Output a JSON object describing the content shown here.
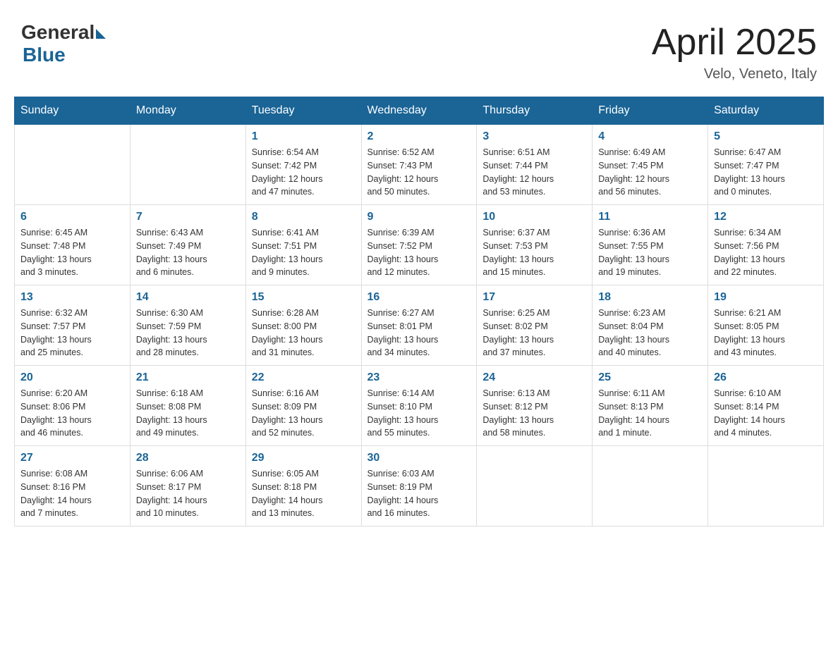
{
  "header": {
    "logo_general": "General",
    "logo_blue": "Blue",
    "title": "April 2025",
    "location": "Velo, Veneto, Italy"
  },
  "calendar": {
    "days_of_week": [
      "Sunday",
      "Monday",
      "Tuesday",
      "Wednesday",
      "Thursday",
      "Friday",
      "Saturday"
    ],
    "weeks": [
      [
        {
          "day": "",
          "info": ""
        },
        {
          "day": "",
          "info": ""
        },
        {
          "day": "1",
          "info": "Sunrise: 6:54 AM\nSunset: 7:42 PM\nDaylight: 12 hours\nand 47 minutes."
        },
        {
          "day": "2",
          "info": "Sunrise: 6:52 AM\nSunset: 7:43 PM\nDaylight: 12 hours\nand 50 minutes."
        },
        {
          "day": "3",
          "info": "Sunrise: 6:51 AM\nSunset: 7:44 PM\nDaylight: 12 hours\nand 53 minutes."
        },
        {
          "day": "4",
          "info": "Sunrise: 6:49 AM\nSunset: 7:45 PM\nDaylight: 12 hours\nand 56 minutes."
        },
        {
          "day": "5",
          "info": "Sunrise: 6:47 AM\nSunset: 7:47 PM\nDaylight: 13 hours\nand 0 minutes."
        }
      ],
      [
        {
          "day": "6",
          "info": "Sunrise: 6:45 AM\nSunset: 7:48 PM\nDaylight: 13 hours\nand 3 minutes."
        },
        {
          "day": "7",
          "info": "Sunrise: 6:43 AM\nSunset: 7:49 PM\nDaylight: 13 hours\nand 6 minutes."
        },
        {
          "day": "8",
          "info": "Sunrise: 6:41 AM\nSunset: 7:51 PM\nDaylight: 13 hours\nand 9 minutes."
        },
        {
          "day": "9",
          "info": "Sunrise: 6:39 AM\nSunset: 7:52 PM\nDaylight: 13 hours\nand 12 minutes."
        },
        {
          "day": "10",
          "info": "Sunrise: 6:37 AM\nSunset: 7:53 PM\nDaylight: 13 hours\nand 15 minutes."
        },
        {
          "day": "11",
          "info": "Sunrise: 6:36 AM\nSunset: 7:55 PM\nDaylight: 13 hours\nand 19 minutes."
        },
        {
          "day": "12",
          "info": "Sunrise: 6:34 AM\nSunset: 7:56 PM\nDaylight: 13 hours\nand 22 minutes."
        }
      ],
      [
        {
          "day": "13",
          "info": "Sunrise: 6:32 AM\nSunset: 7:57 PM\nDaylight: 13 hours\nand 25 minutes."
        },
        {
          "day": "14",
          "info": "Sunrise: 6:30 AM\nSunset: 7:59 PM\nDaylight: 13 hours\nand 28 minutes."
        },
        {
          "day": "15",
          "info": "Sunrise: 6:28 AM\nSunset: 8:00 PM\nDaylight: 13 hours\nand 31 minutes."
        },
        {
          "day": "16",
          "info": "Sunrise: 6:27 AM\nSunset: 8:01 PM\nDaylight: 13 hours\nand 34 minutes."
        },
        {
          "day": "17",
          "info": "Sunrise: 6:25 AM\nSunset: 8:02 PM\nDaylight: 13 hours\nand 37 minutes."
        },
        {
          "day": "18",
          "info": "Sunrise: 6:23 AM\nSunset: 8:04 PM\nDaylight: 13 hours\nand 40 minutes."
        },
        {
          "day": "19",
          "info": "Sunrise: 6:21 AM\nSunset: 8:05 PM\nDaylight: 13 hours\nand 43 minutes."
        }
      ],
      [
        {
          "day": "20",
          "info": "Sunrise: 6:20 AM\nSunset: 8:06 PM\nDaylight: 13 hours\nand 46 minutes."
        },
        {
          "day": "21",
          "info": "Sunrise: 6:18 AM\nSunset: 8:08 PM\nDaylight: 13 hours\nand 49 minutes."
        },
        {
          "day": "22",
          "info": "Sunrise: 6:16 AM\nSunset: 8:09 PM\nDaylight: 13 hours\nand 52 minutes."
        },
        {
          "day": "23",
          "info": "Sunrise: 6:14 AM\nSunset: 8:10 PM\nDaylight: 13 hours\nand 55 minutes."
        },
        {
          "day": "24",
          "info": "Sunrise: 6:13 AM\nSunset: 8:12 PM\nDaylight: 13 hours\nand 58 minutes."
        },
        {
          "day": "25",
          "info": "Sunrise: 6:11 AM\nSunset: 8:13 PM\nDaylight: 14 hours\nand 1 minute."
        },
        {
          "day": "26",
          "info": "Sunrise: 6:10 AM\nSunset: 8:14 PM\nDaylight: 14 hours\nand 4 minutes."
        }
      ],
      [
        {
          "day": "27",
          "info": "Sunrise: 6:08 AM\nSunset: 8:16 PM\nDaylight: 14 hours\nand 7 minutes."
        },
        {
          "day": "28",
          "info": "Sunrise: 6:06 AM\nSunset: 8:17 PM\nDaylight: 14 hours\nand 10 minutes."
        },
        {
          "day": "29",
          "info": "Sunrise: 6:05 AM\nSunset: 8:18 PM\nDaylight: 14 hours\nand 13 minutes."
        },
        {
          "day": "30",
          "info": "Sunrise: 6:03 AM\nSunset: 8:19 PM\nDaylight: 14 hours\nand 16 minutes."
        },
        {
          "day": "",
          "info": ""
        },
        {
          "day": "",
          "info": ""
        },
        {
          "day": "",
          "info": ""
        }
      ]
    ]
  }
}
